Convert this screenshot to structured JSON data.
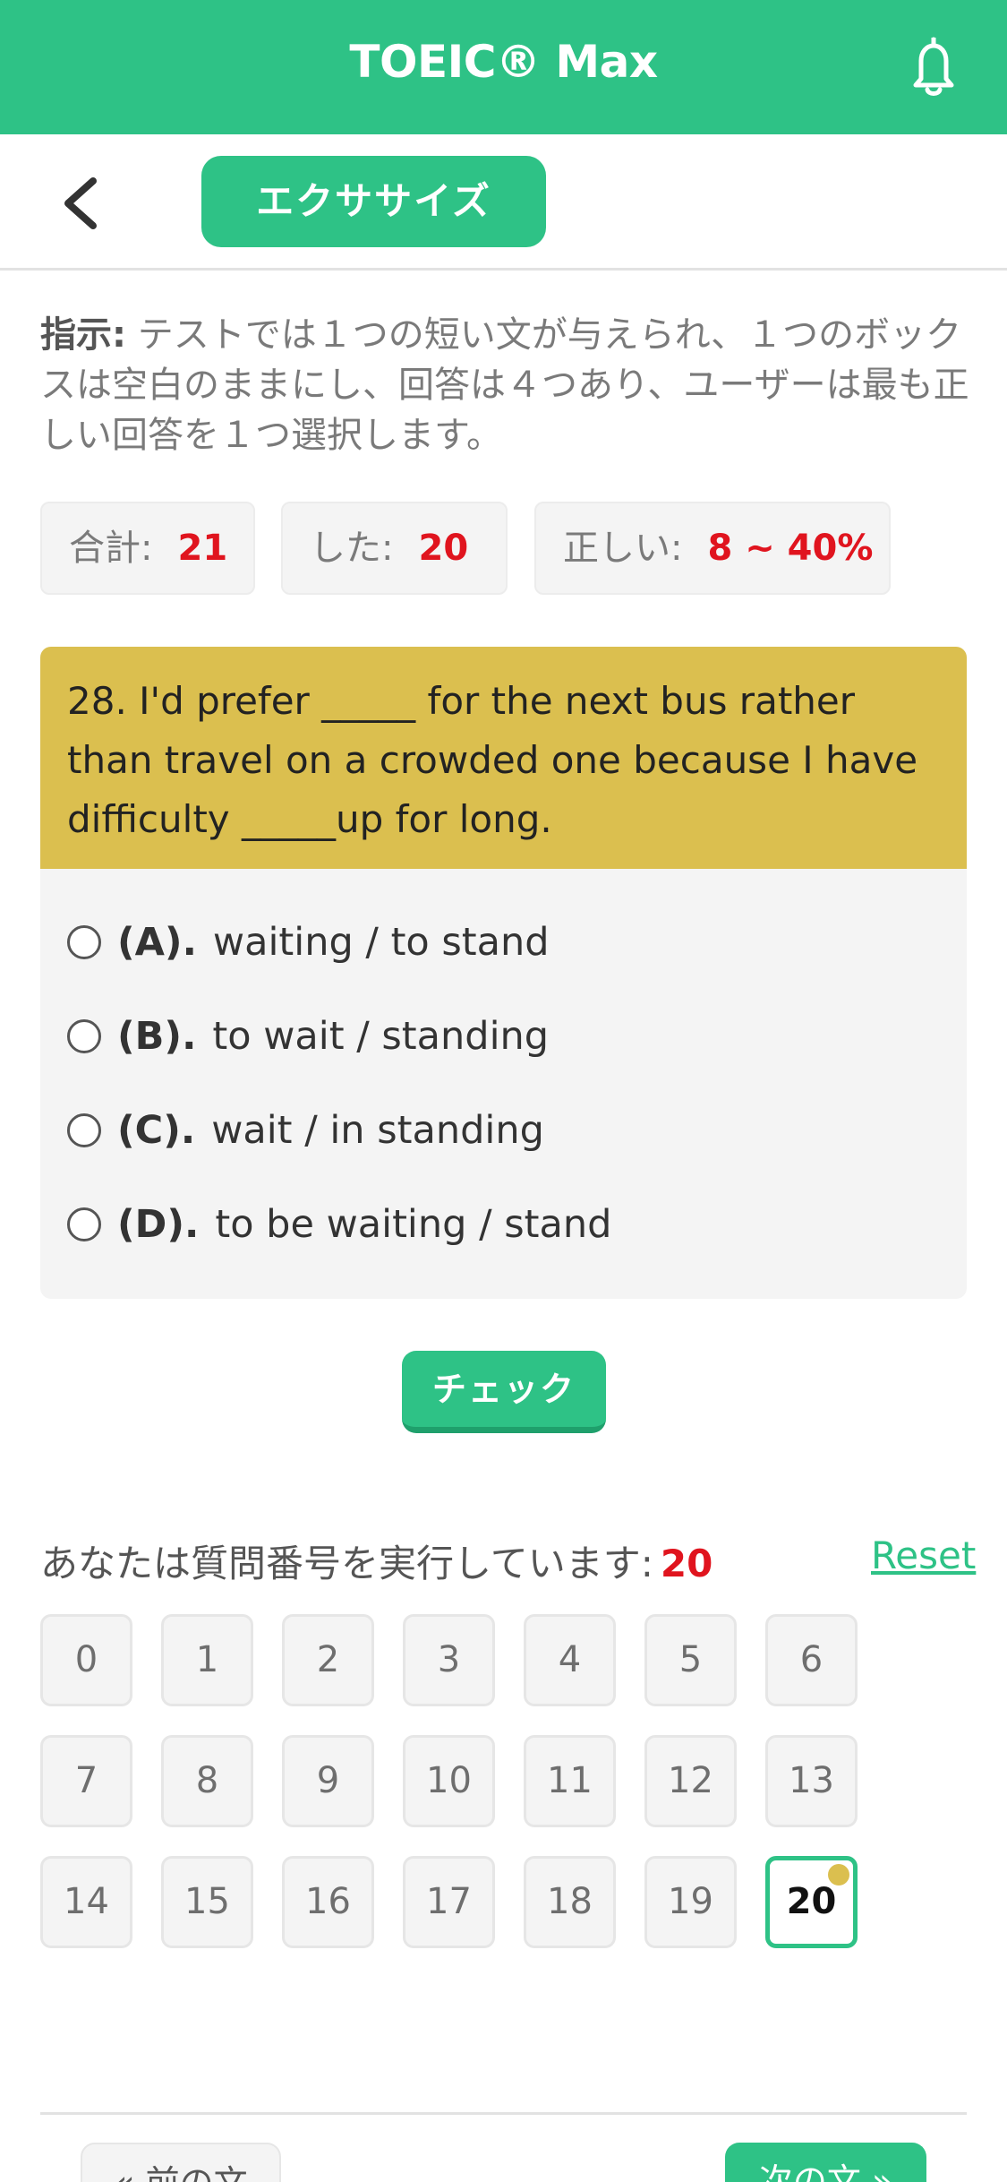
{
  "app": {
    "title": "TOEIC® Max"
  },
  "icons": {
    "bell": "bell-icon",
    "back": "chevron-left-icon"
  },
  "colors": {
    "brand": "#2ec286",
    "question_header": "#dbbf4f",
    "accent_red": "#e0141e",
    "current_dot": "#dbbf4f"
  },
  "nav": {
    "tab_label": "エクササイズ"
  },
  "instructions": {
    "label": "指示:",
    "text": " テストでは１つの短い文が与えられ、１つのボックスは空白のままにし、回答は４つあり、ユーザーは最も正しい回答を１つ選択します。"
  },
  "stats": {
    "total_label": "合計:",
    "total_value": "21",
    "done_label": "した:",
    "done_value": "20",
    "correct_label": "正しい:",
    "correct_value": "8 ~ 40%"
  },
  "question": {
    "text": "28. I'd prefer _____ for the next bus rather than travel on a crowded one because I have difficulty _____up for long.",
    "options": [
      {
        "letter": "(A).",
        "text": "waiting / to stand"
      },
      {
        "letter": "(B).",
        "text": "to wait / standing"
      },
      {
        "letter": "(C).",
        "text": "wait / in standing"
      },
      {
        "letter": "(D).",
        "text": "to be waiting / stand"
      }
    ]
  },
  "check_label": "チェック",
  "progress": {
    "label": "あなたは質問番号を実行しています:",
    "current": "20",
    "reset_label": "Reset"
  },
  "question_numbers": [
    "0",
    "1",
    "2",
    "3",
    "4",
    "5",
    "6",
    "7",
    "8",
    "9",
    "10",
    "11",
    "12",
    "13",
    "14",
    "15",
    "16",
    "17",
    "18",
    "19",
    "20"
  ],
  "current_question_index": 20,
  "footer": {
    "prev_label": "« 前の文",
    "next_label": "次の文 »"
  }
}
